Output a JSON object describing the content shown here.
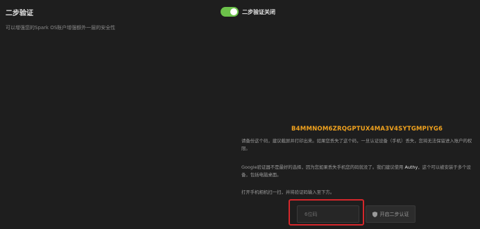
{
  "section": {
    "title": "二步验证",
    "description": "可以增强您的Spark OS账户增强额外一层的安全性"
  },
  "toggle": {
    "label": "二步验证关闭",
    "state": "on",
    "color": "#6cc24a"
  },
  "secret_key": "B4MMNOM6ZRQGPTUX4MA3V4SYTGMPIYG6",
  "instructions": {
    "p1": "请备份这个码，建议截屏并打印出来。如果您丢失了这个码，一旦认证设备（手机）丢失，您将无法保留进入账户的权限。",
    "p2_before": "Google验证器不是最好的选择，因为您如果丢失手机您的码就没了。我们建议使用 ",
    "p2_app": "Authy",
    "p2_after": "，这个可以被安装于多个设备，包括电脑桌面。",
    "p3": "打开手机相机扫一扫，并将验证码输入至下方。"
  },
  "code_input": {
    "placeholder": "6位码",
    "value": ""
  },
  "enable_button": {
    "label": "开启二步认证",
    "icon": "shield-icon"
  },
  "colors": {
    "background": "#1e1e1e",
    "accent": "#f0a21e",
    "highlight_border": "#d6272b"
  }
}
